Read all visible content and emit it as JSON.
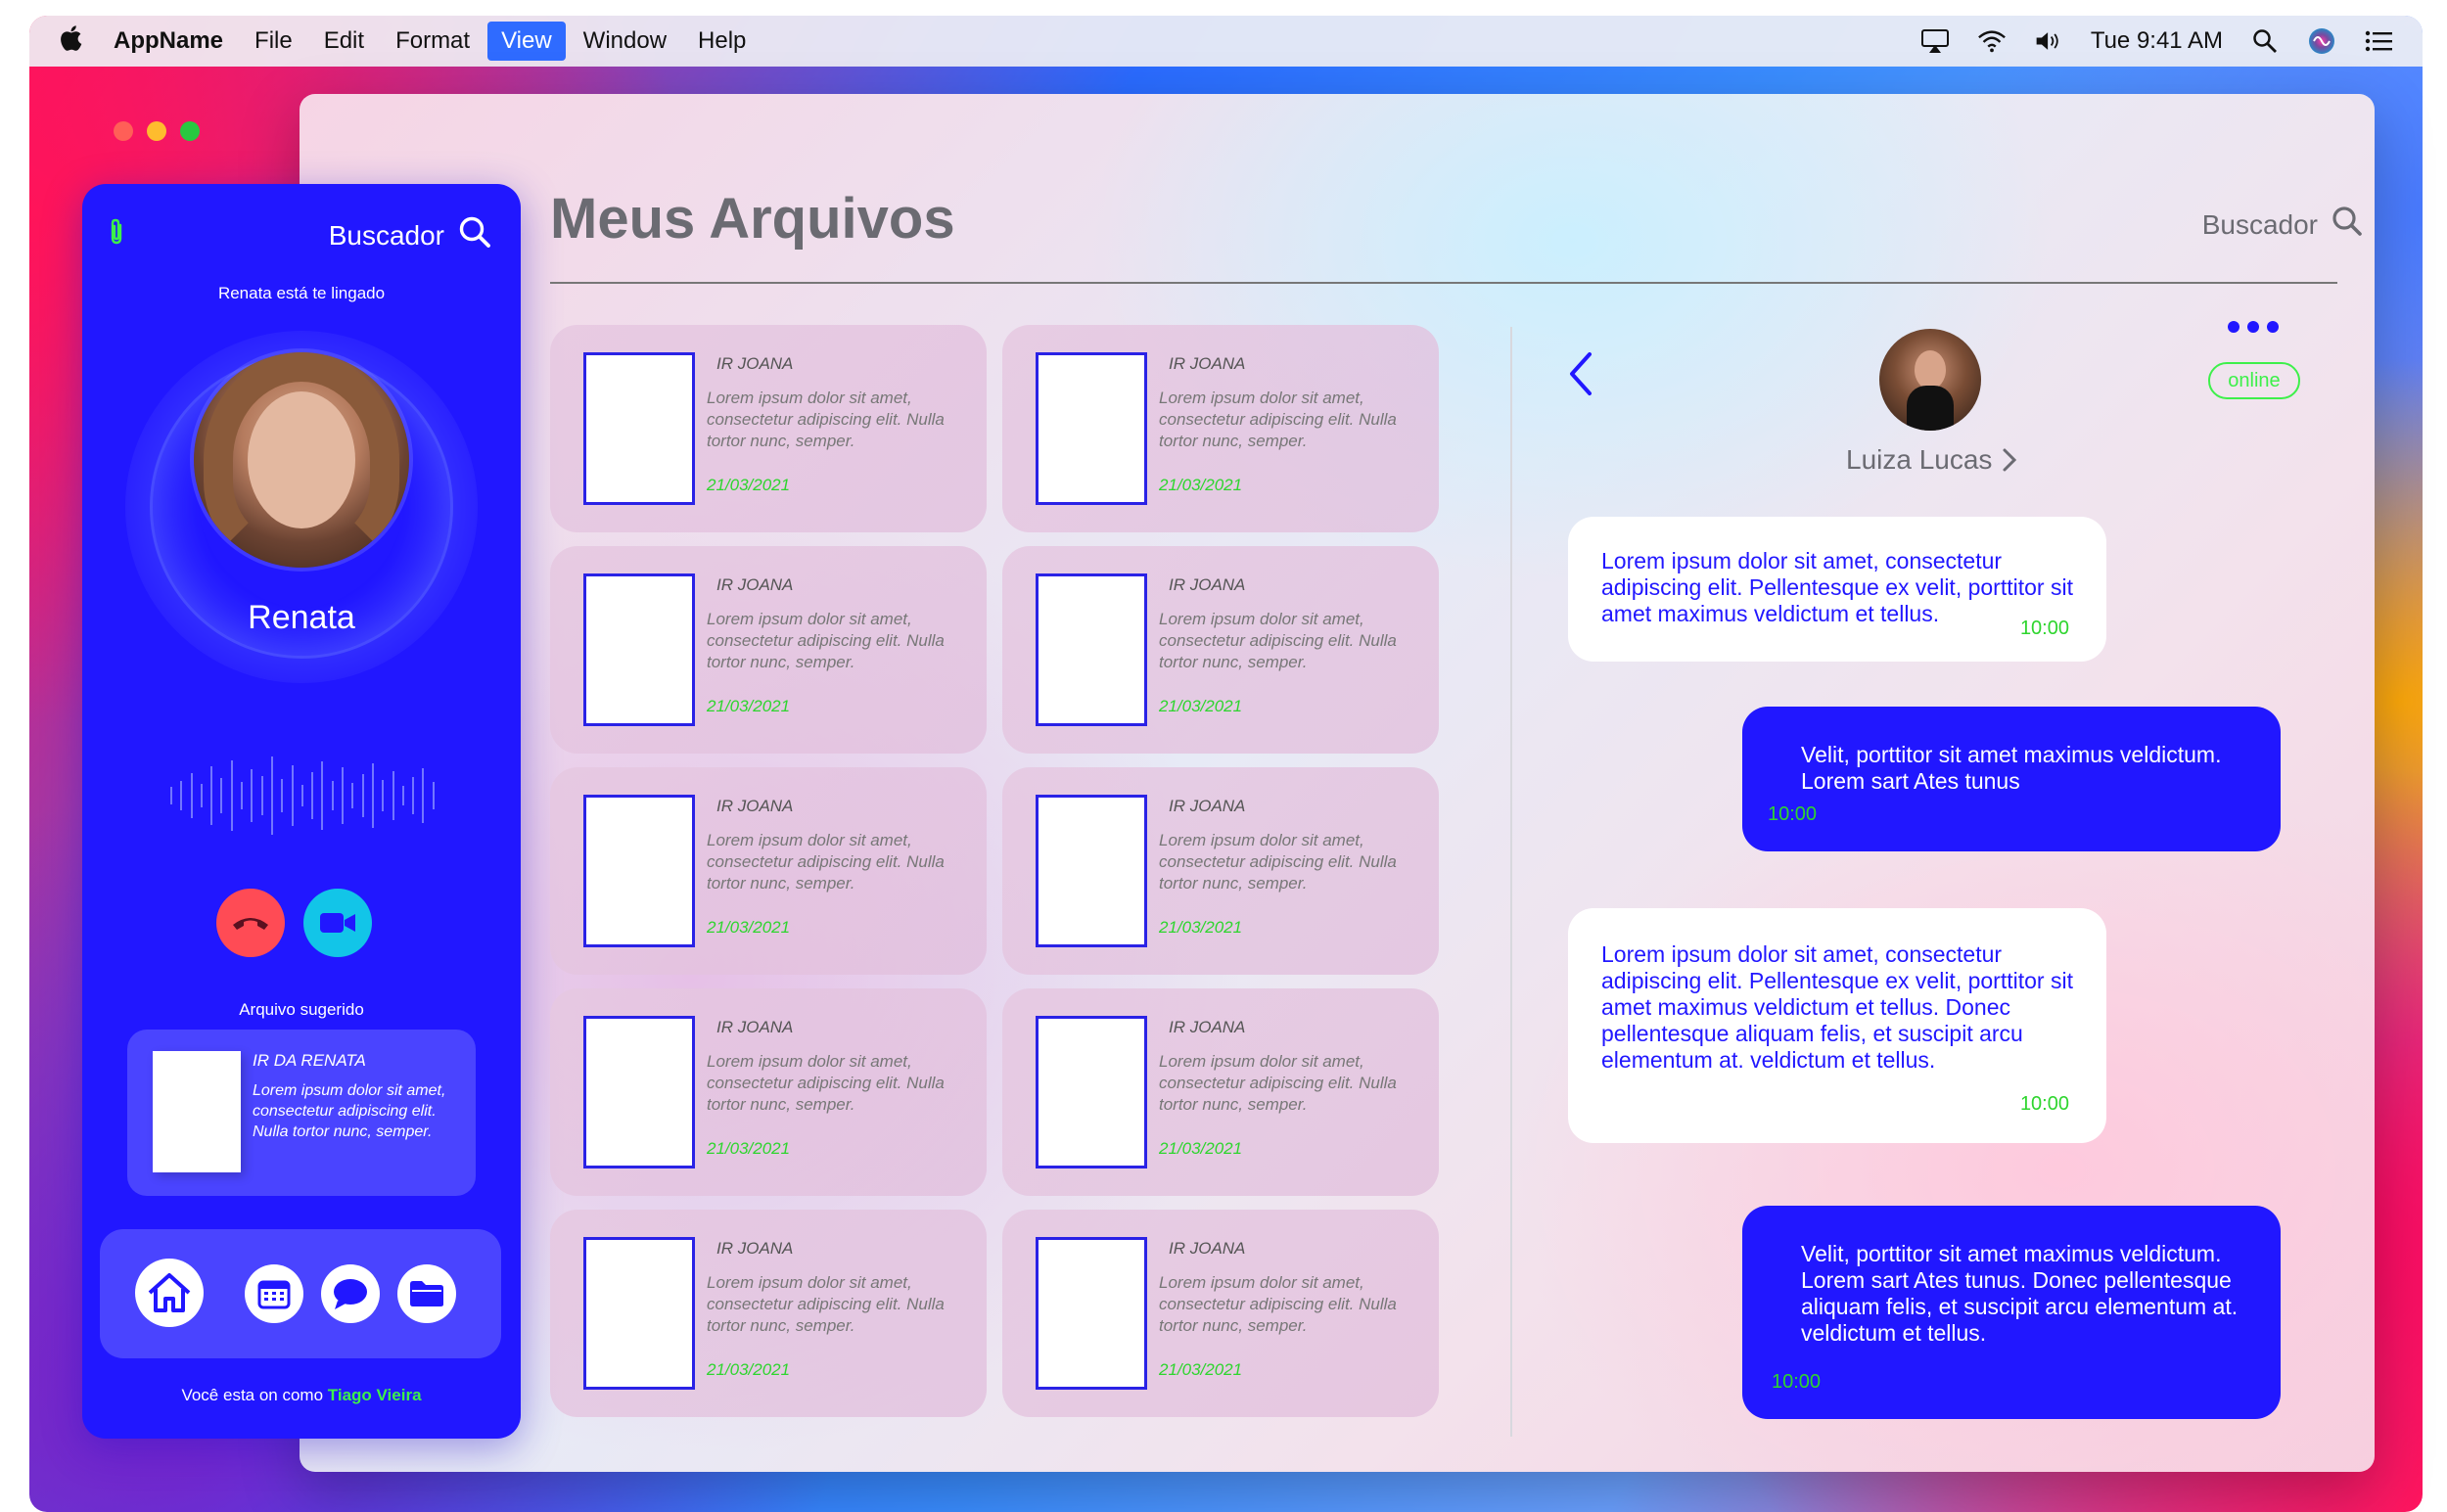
{
  "menubar": {
    "app_name": "AppName",
    "items": [
      "File",
      "Edit",
      "Format",
      "View",
      "Window",
      "Help"
    ],
    "active_item": "View",
    "clock": "Tue 9:41 AM"
  },
  "call_panel": {
    "search_label": "Buscador",
    "calling_text": "Renata está te lingado",
    "caller_name": "Renata",
    "suggested_title": "Arquivo sugerido",
    "suggested_file": {
      "title": "IR DA RENATA",
      "text": "Lorem ipsum dolor sit amet, consectetur adipiscing elit. Nulla tortor nunc, semper."
    },
    "footer_prefix": "Você esta on como",
    "footer_user": "Tiago Vieira"
  },
  "files": {
    "title": "Meus Arquivos",
    "search_label": "Buscador",
    "items": [
      {
        "title": "IR JOANA",
        "text": "Lorem ipsum dolor sit amet, consectetur adipiscing elit. Nulla tortor nunc, semper.",
        "date": "21/03/2021"
      },
      {
        "title": "IR JOANA",
        "text": "Lorem ipsum dolor sit amet, consectetur adipiscing elit. Nulla tortor nunc, semper.",
        "date": "21/03/2021"
      },
      {
        "title": "IR JOANA",
        "text": "Lorem ipsum dolor sit amet, consectetur adipiscing elit. Nulla tortor nunc, semper.",
        "date": "21/03/2021"
      },
      {
        "title": "IR JOANA",
        "text": "Lorem ipsum dolor sit amet, consectetur adipiscing elit. Nulla tortor nunc, semper.",
        "date": "21/03/2021"
      },
      {
        "title": "IR JOANA",
        "text": "Lorem ipsum dolor sit amet, consectetur adipiscing elit. Nulla tortor nunc, semper.",
        "date": "21/03/2021"
      },
      {
        "title": "IR JOANA",
        "text": "Lorem ipsum dolor sit amet, consectetur adipiscing elit. Nulla tortor nunc, semper.",
        "date": "21/03/2021"
      },
      {
        "title": "IR JOANA",
        "text": "Lorem ipsum dolor sit amet, consectetur adipiscing elit. Nulla tortor nunc, semper.",
        "date": "21/03/2021"
      },
      {
        "title": "IR JOANA",
        "text": "Lorem ipsum dolor sit amet, consectetur adipiscing elit. Nulla tortor nunc, semper.",
        "date": "21/03/2021"
      },
      {
        "title": "IR JOANA",
        "text": "Lorem ipsum dolor sit amet, consectetur adipiscing elit. Nulla tortor nunc, semper.",
        "date": "21/03/2021"
      },
      {
        "title": "IR JOANA",
        "text": "Lorem ipsum dolor sit amet, consectetur adipiscing elit. Nulla tortor nunc, semper.",
        "date": "21/03/2021"
      }
    ]
  },
  "chat": {
    "contact_name": "Luiza Lucas",
    "status": "online",
    "messages": [
      {
        "direction": "in",
        "text": "Lorem ipsum dolor sit amet, consectetur adipiscing elit. Pellentesque ex velit, porttitor sit amet maximus veldictum et tellus.",
        "time": "10:00"
      },
      {
        "direction": "out",
        "text": "Velit, porttitor sit amet maximus  veldictum. Lorem sart Ates tunus",
        "time": "10:00"
      },
      {
        "direction": "in",
        "text": "Lorem ipsum dolor sit amet, consectetur adipiscing elit. Pellentesque ex velit, porttitor sit amet maximus veldictum et tellus. Donec pellentesque aliquam felis, et suscipit arcu elementum at. veldictum et tellus.",
        "time": "10:00"
      },
      {
        "direction": "out",
        "text": "Velit, porttitor sit amet maximus  veldictum. Lorem sart Ates tunus. Donec pellentesque aliquam felis, et suscipit arcu elementum at. veldictum et tellus.",
        "time": "10:00"
      }
    ]
  },
  "colors": {
    "accent": "#2117ff",
    "success": "#3df04a",
    "hangup": "#ff4b55",
    "video": "#12c5e8"
  }
}
